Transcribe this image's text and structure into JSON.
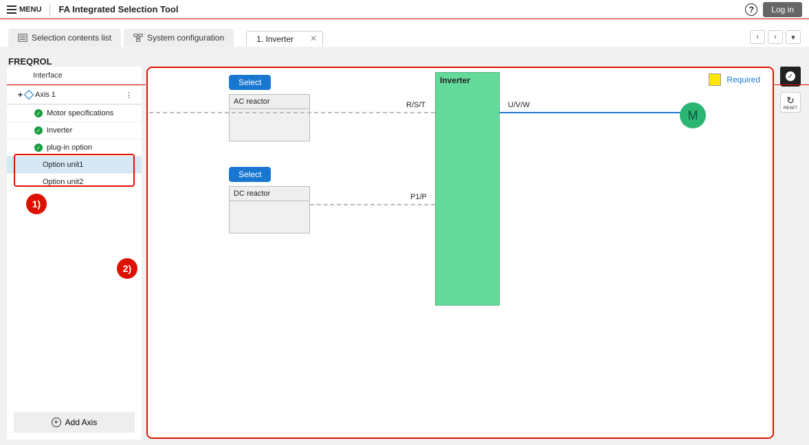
{
  "header": {
    "menu_label": "MENU",
    "app_title": "FA Integrated Selection Tool",
    "login_label": "Log in"
  },
  "tabs": {
    "selection_contents": "Selection contents list",
    "system_config": "System configuration",
    "active_tab": "1. Inverter"
  },
  "page_title": "FREQROL",
  "tree": {
    "interface": "Interface",
    "axis1": "Axis 1",
    "motor_spec": "Motor specifications",
    "inverter": "Inverter",
    "plugin": "plug-in option",
    "opt1": "Option unit1",
    "opt2": "Option unit2"
  },
  "add_axis": "Add Axis",
  "annotations": {
    "a1": "1)",
    "a2": "2)"
  },
  "diagram": {
    "select_label": "Select",
    "ac_reactor": "AC reactor",
    "dc_reactor": "DC reactor",
    "inverter": "Inverter",
    "rst": "R/S/T",
    "uvw": "U/V/W",
    "p1p": "P1/P",
    "motor": "M",
    "required": "Required"
  },
  "tools": {
    "reset": "RESET"
  }
}
